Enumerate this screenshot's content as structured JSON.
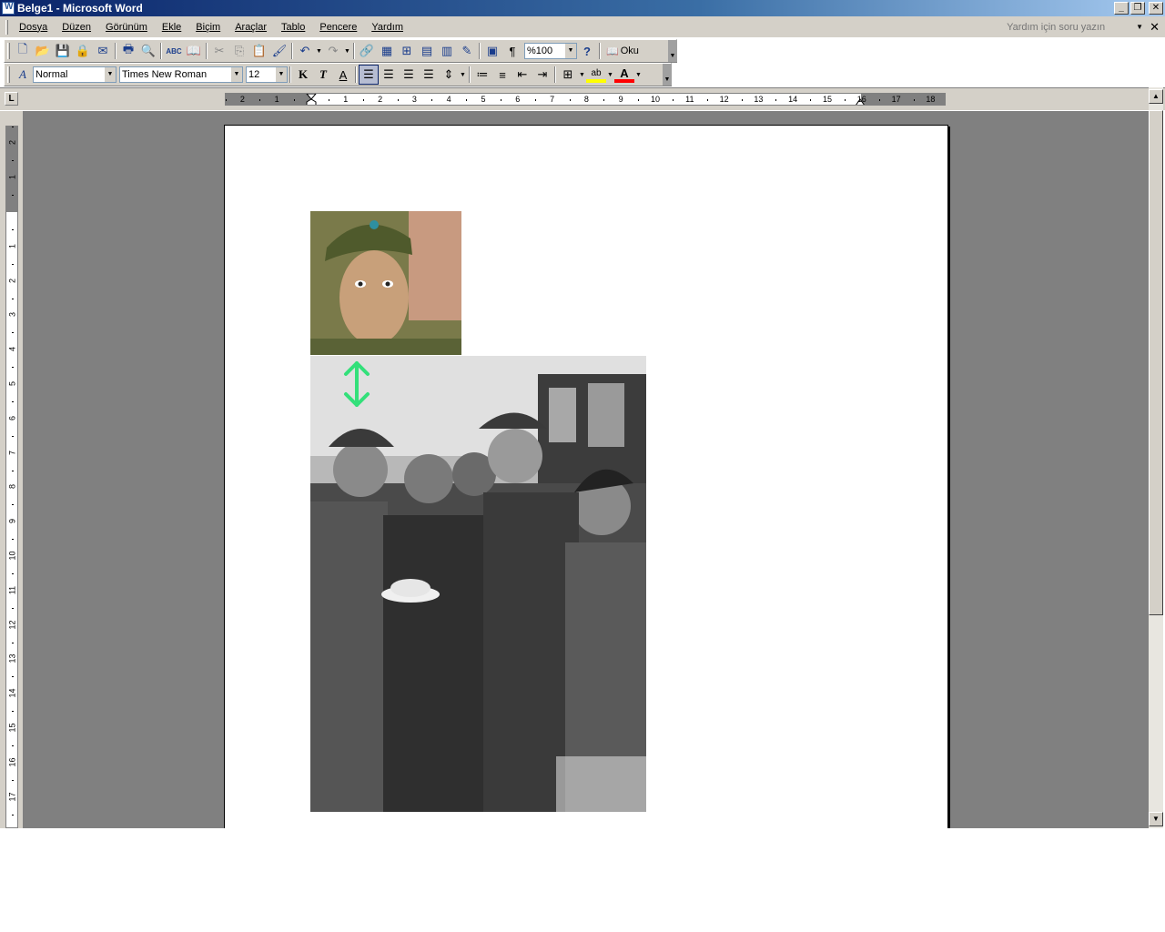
{
  "window": {
    "title": "Belge1 - Microsoft Word",
    "min_glyph": "_",
    "restore_glyph": "❐",
    "close_glyph": "✕"
  },
  "menu": {
    "items": [
      {
        "label": "Dosya"
      },
      {
        "label": "Düzen"
      },
      {
        "label": "Görünüm"
      },
      {
        "label": "Ekle"
      },
      {
        "label": "Biçim"
      },
      {
        "label": "Araçlar"
      },
      {
        "label": "Tablo"
      },
      {
        "label": "Pencere"
      },
      {
        "label": "Yardım"
      }
    ],
    "help_placeholder": "Yardım için soru yazın",
    "doc_close": "✕"
  },
  "standard_toolbar": {
    "zoom": "%100",
    "read_label": "Oku",
    "icons": {
      "new": "🗋",
      "open": "📂",
      "save": "💾",
      "permission": "🔒",
      "email": "✉",
      "print": "🖶",
      "preview": "🔍",
      "spell": "ABC",
      "research": "📖",
      "cut": "✂",
      "copy": "⎘",
      "paste": "📋",
      "format_painter": "🖌",
      "undo": "↶",
      "redo": "↷",
      "hyperlink": "🔗",
      "tables_borders": "▦",
      "insert_table": "⊞",
      "insert_excel": "▤",
      "columns": "▥",
      "drawing": "✎",
      "doc_map": "▣",
      "show_marks": "¶",
      "help": "?"
    }
  },
  "formatting_toolbar": {
    "style": "Normal",
    "font": "Times New Roman",
    "size": "12",
    "bold": "K",
    "italic": "T",
    "underline": "A",
    "font_color_glyph": "A",
    "highlight_glyph": "ab"
  },
  "ruler": {
    "tab_selector": "L",
    "h_numbers": [
      "2",
      "1",
      "1",
      "2",
      "3",
      "4",
      "5",
      "6",
      "7",
      "8",
      "9",
      "10",
      "11",
      "12",
      "13",
      "14",
      "15",
      "16",
      "17",
      "18"
    ],
    "v_numbers": [
      "2",
      "1",
      "1",
      "2",
      "3",
      "4",
      "5",
      "6",
      "7",
      "8",
      "9",
      "10",
      "11",
      "12",
      "13",
      "14",
      "15",
      "16",
      "17"
    ]
  },
  "scrollbar": {
    "up": "▲",
    "down": "▼"
  },
  "colors": {
    "accent_arrow": "#33e07a"
  }
}
